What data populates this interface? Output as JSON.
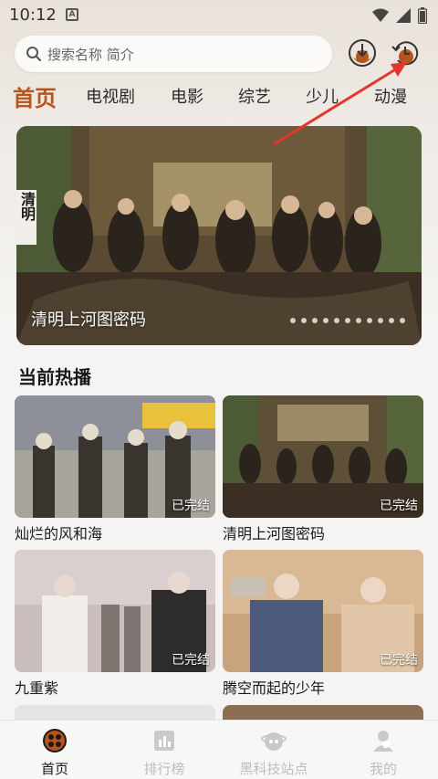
{
  "status_bar": {
    "time": "10:12",
    "notification": "A"
  },
  "search": {
    "placeholder": "搜索名称 简介"
  },
  "tabs": [
    {
      "label": "首页",
      "active": true
    },
    {
      "label": "电视剧"
    },
    {
      "label": "电影"
    },
    {
      "label": "综艺"
    },
    {
      "label": "少儿"
    },
    {
      "label": "动漫"
    }
  ],
  "banner": {
    "title": "清明上河图密码",
    "side_text": "清明",
    "dot_count": 11,
    "active_dot": 0
  },
  "section": {
    "title": "当前热播"
  },
  "cards": [
    {
      "title": "灿烂的风和海",
      "badge": "已完结"
    },
    {
      "title": "清明上河图密码",
      "badge": "已完结"
    },
    {
      "title": "九重紫",
      "badge": "已完结"
    },
    {
      "title": "腾空而起的少年",
      "badge": "已完结"
    }
  ],
  "bottom_nav": [
    {
      "label": "首页",
      "icon": "home-film-reel-icon",
      "active": true
    },
    {
      "label": "排行榜",
      "icon": "ranking-chart-icon"
    },
    {
      "label": "黑科技站点",
      "icon": "tech-site-icon"
    },
    {
      "label": "我的",
      "icon": "profile-icon"
    }
  ],
  "colors": {
    "accent": "#b5541f",
    "arrow": "#e8352b",
    "icon_brown": "#b5541f"
  }
}
